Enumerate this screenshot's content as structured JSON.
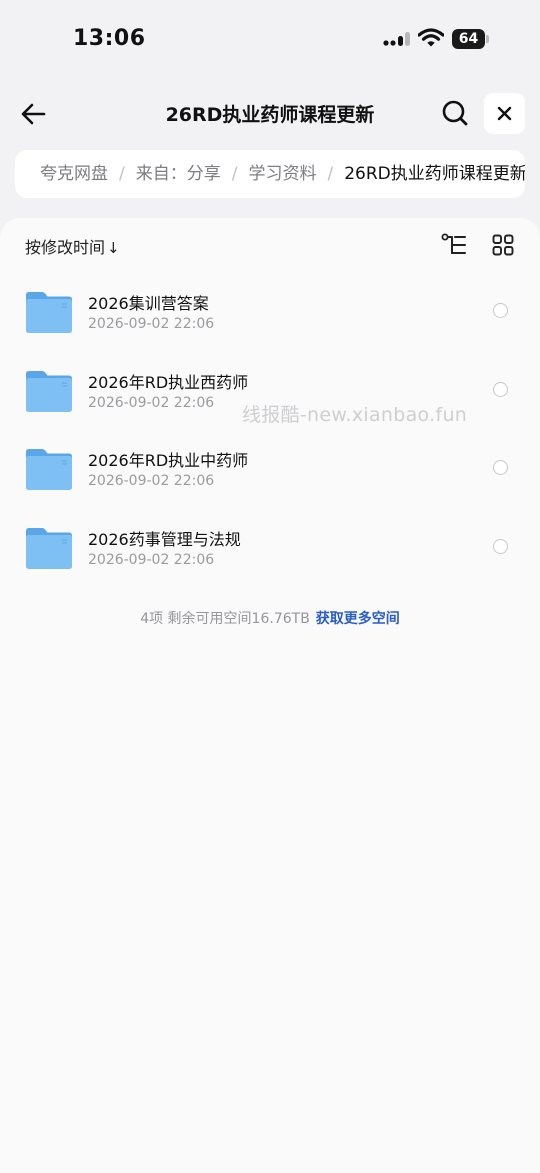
{
  "status_bar": {
    "time": "13:06",
    "battery": "64"
  },
  "nav": {
    "title": "26RD执业药师课程更新"
  },
  "breadcrumb": {
    "items": [
      "夸克网盘",
      "来自：分享",
      "学习资料",
      "26RD执业药师课程更新"
    ],
    "separator": "/"
  },
  "toolbar": {
    "sort_label": "按修改时间",
    "sort_arrow": "↓"
  },
  "files": [
    {
      "name": "2026集训营答案",
      "date": "2026-09-02 22:06"
    },
    {
      "name": "2026年RD执业西药师",
      "date": "2026-09-02 22:06"
    },
    {
      "name": "2026年RD执业中药师",
      "date": "2026-09-02 22:06"
    },
    {
      "name": "2026药事管理与法规",
      "date": "2026-09-02 22:06"
    }
  ],
  "footer": {
    "count_text": "4项 剩余可用空间16.76TB",
    "link_text": "获取更多空间"
  },
  "watermark": "线报酷-new.xianbao.fun",
  "colors": {
    "accent": "#2a5fc4",
    "folder": "#6cb3ee"
  },
  "icons": [
    "back-arrow-icon",
    "search-icon",
    "close-icon",
    "tree-view-icon",
    "grid-view-icon",
    "folder-icon"
  ]
}
